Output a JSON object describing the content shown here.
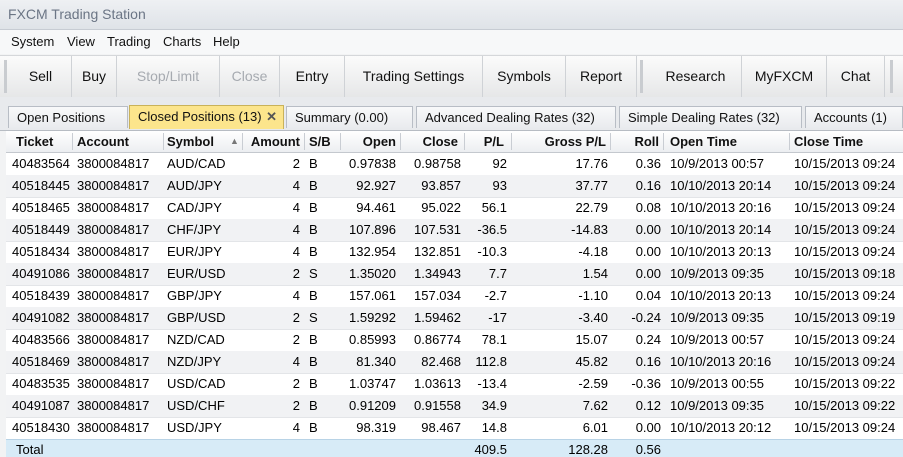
{
  "window": {
    "title": "FXCM Trading Station"
  },
  "menu": [
    "System",
    "View",
    "Trading",
    "Charts",
    "Help"
  ],
  "toolbar": {
    "buttons": [
      "Sell",
      "Buy",
      "Stop/Limit",
      "Close",
      "Entry",
      "Trading Settings",
      "Symbols",
      "Report",
      "Research",
      "MyFXCM",
      "Chat"
    ],
    "disabled": [
      "Stop/Limit",
      "Close"
    ]
  },
  "tabs": [
    "Open Positions",
    "Closed Positions (13)",
    "Summary (0.00)",
    "Advanced Dealing Rates (32)",
    "Simple Dealing Rates (32)",
    "Accounts (1)"
  ],
  "active_tab": "Closed Positions (13)",
  "table": {
    "columns": [
      "Ticket",
      "Account",
      "Symbol",
      "Amount",
      "S/B",
      "Open",
      "Close",
      "P/L",
      "Gross P/L",
      "Roll",
      "Open Time",
      "Close Time"
    ],
    "sort_column": "Symbol",
    "rows": [
      [
        "40483564",
        "3800084817",
        "AUD/CAD",
        "2",
        "B",
        "0.97838",
        "0.98758",
        "92",
        "17.76",
        "0.36",
        "10/9/2013 00:57",
        "10/15/2013 09:24"
      ],
      [
        "40518445",
        "3800084817",
        "AUD/JPY",
        "4",
        "B",
        "92.927",
        "93.857",
        "93",
        "37.77",
        "0.16",
        "10/10/2013 20:14",
        "10/15/2013 09:24"
      ],
      [
        "40518465",
        "3800084817",
        "CAD/JPY",
        "4",
        "B",
        "94.461",
        "95.022",
        "56.1",
        "22.79",
        "0.08",
        "10/10/2013 20:16",
        "10/15/2013 09:24"
      ],
      [
        "40518449",
        "3800084817",
        "CHF/JPY",
        "4",
        "B",
        "107.896",
        "107.531",
        "-36.5",
        "-14.83",
        "0.00",
        "10/10/2013 20:14",
        "10/15/2013 09:24"
      ],
      [
        "40518434",
        "3800084817",
        "EUR/JPY",
        "4",
        "B",
        "132.954",
        "132.851",
        "-10.3",
        "-4.18",
        "0.00",
        "10/10/2013 20:13",
        "10/15/2013 09:24"
      ],
      [
        "40491086",
        "3800084817",
        "EUR/USD",
        "2",
        "S",
        "1.35020",
        "1.34943",
        "7.7",
        "1.54",
        "0.00",
        "10/9/2013 09:35",
        "10/15/2013 09:18"
      ],
      [
        "40518439",
        "3800084817",
        "GBP/JPY",
        "4",
        "B",
        "157.061",
        "157.034",
        "-2.7",
        "-1.10",
        "0.04",
        "10/10/2013 20:13",
        "10/15/2013 09:24"
      ],
      [
        "40491082",
        "3800084817",
        "GBP/USD",
        "2",
        "S",
        "1.59292",
        "1.59462",
        "-17",
        "-3.40",
        "-0.24",
        "10/9/2013 09:35",
        "10/15/2013 09:19"
      ],
      [
        "40483566",
        "3800084817",
        "NZD/CAD",
        "2",
        "B",
        "0.85993",
        "0.86774",
        "78.1",
        "15.07",
        "0.24",
        "10/9/2013 00:57",
        "10/15/2013 09:24"
      ],
      [
        "40518469",
        "3800084817",
        "NZD/JPY",
        "4",
        "B",
        "81.340",
        "82.468",
        "112.8",
        "45.82",
        "0.16",
        "10/10/2013 20:16",
        "10/15/2013 09:24"
      ],
      [
        "40483535",
        "3800084817",
        "USD/CAD",
        "2",
        "B",
        "1.03747",
        "1.03613",
        "-13.4",
        "-2.59",
        "-0.36",
        "10/9/2013 00:55",
        "10/15/2013 09:22"
      ],
      [
        "40491087",
        "3800084817",
        "USD/CHF",
        "2",
        "B",
        "0.91209",
        "0.91558",
        "34.9",
        "7.62",
        "0.12",
        "10/9/2013 09:35",
        "10/15/2013 09:22"
      ],
      [
        "40518430",
        "3800084817",
        "USD/JPY",
        "4",
        "B",
        "98.319",
        "98.467",
        "14.8",
        "6.01",
        "0.00",
        "10/10/2013 20:12",
        "10/15/2013 09:24"
      ]
    ],
    "total": {
      "label": "Total",
      "pl": "409.5",
      "gross_pl": "128.28",
      "roll": "0.56"
    }
  },
  "colors": {
    "active_tab": "#fce58c",
    "total_row": "#d7ebf7",
    "alt_row": "#f1f2f4"
  }
}
